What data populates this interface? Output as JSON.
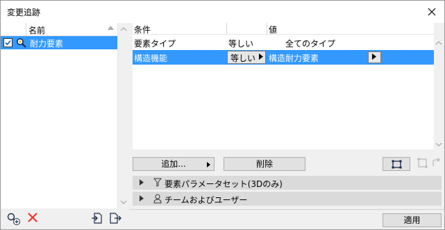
{
  "window": {
    "title": "変更追跡"
  },
  "left": {
    "header": {
      "name": "名前"
    },
    "items": [
      {
        "label": "耐力要素",
        "checked": true,
        "icon": "filter-magnifier-icon"
      }
    ]
  },
  "criteria": {
    "headers": {
      "condition": "条件",
      "value": "値"
    },
    "rows": [
      {
        "property": "要素タイプ",
        "operator": "等しい",
        "value": "全てのタイプ"
      },
      {
        "property": "構造機能",
        "operator": "等しい",
        "value": "構造耐力要素",
        "selected": true
      }
    ]
  },
  "buttons": {
    "add": "追加...",
    "delete": "削除",
    "apply": "適用"
  },
  "sections": [
    {
      "label": "要素パラメータセット(3Dのみ)",
      "icon": "filter-icon"
    },
    {
      "label": "チームおよびユーザー",
      "icon": "user-icon"
    }
  ],
  "colors": {
    "selection": "#3399ff",
    "delete_red": "#e8362a"
  }
}
